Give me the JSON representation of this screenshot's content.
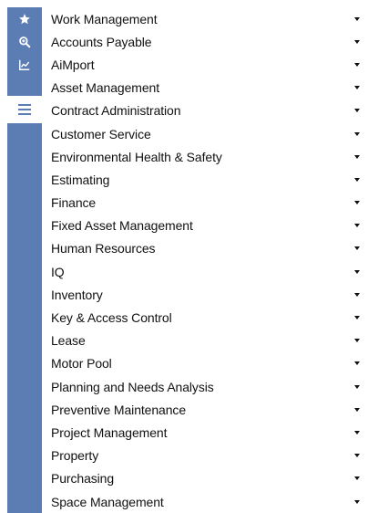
{
  "rail": {
    "buttons": [
      {
        "icon": "star-icon"
      },
      {
        "icon": "search-zoom-icon"
      },
      {
        "icon": "chart-icon"
      },
      {
        "icon": "hamburger-menu-icon"
      }
    ],
    "accent_color": "#5b7db4"
  },
  "menu": {
    "items": [
      {
        "label": "Work Management"
      },
      {
        "label": "Accounts Payable"
      },
      {
        "label": "AiMport"
      },
      {
        "label": "Asset Management"
      },
      {
        "label": "Contract Administration"
      },
      {
        "label": "Customer Service"
      },
      {
        "label": "Environmental Health & Safety"
      },
      {
        "label": "Estimating"
      },
      {
        "label": "Finance"
      },
      {
        "label": "Fixed Asset Management"
      },
      {
        "label": "Human Resources"
      },
      {
        "label": "IQ"
      },
      {
        "label": "Inventory"
      },
      {
        "label": "Key & Access Control"
      },
      {
        "label": "Lease"
      },
      {
        "label": "Motor Pool"
      },
      {
        "label": "Planning and Needs Analysis"
      },
      {
        "label": "Preventive Maintenance"
      },
      {
        "label": "Project Management"
      },
      {
        "label": "Property"
      },
      {
        "label": "Purchasing"
      },
      {
        "label": "Space Management"
      }
    ]
  }
}
